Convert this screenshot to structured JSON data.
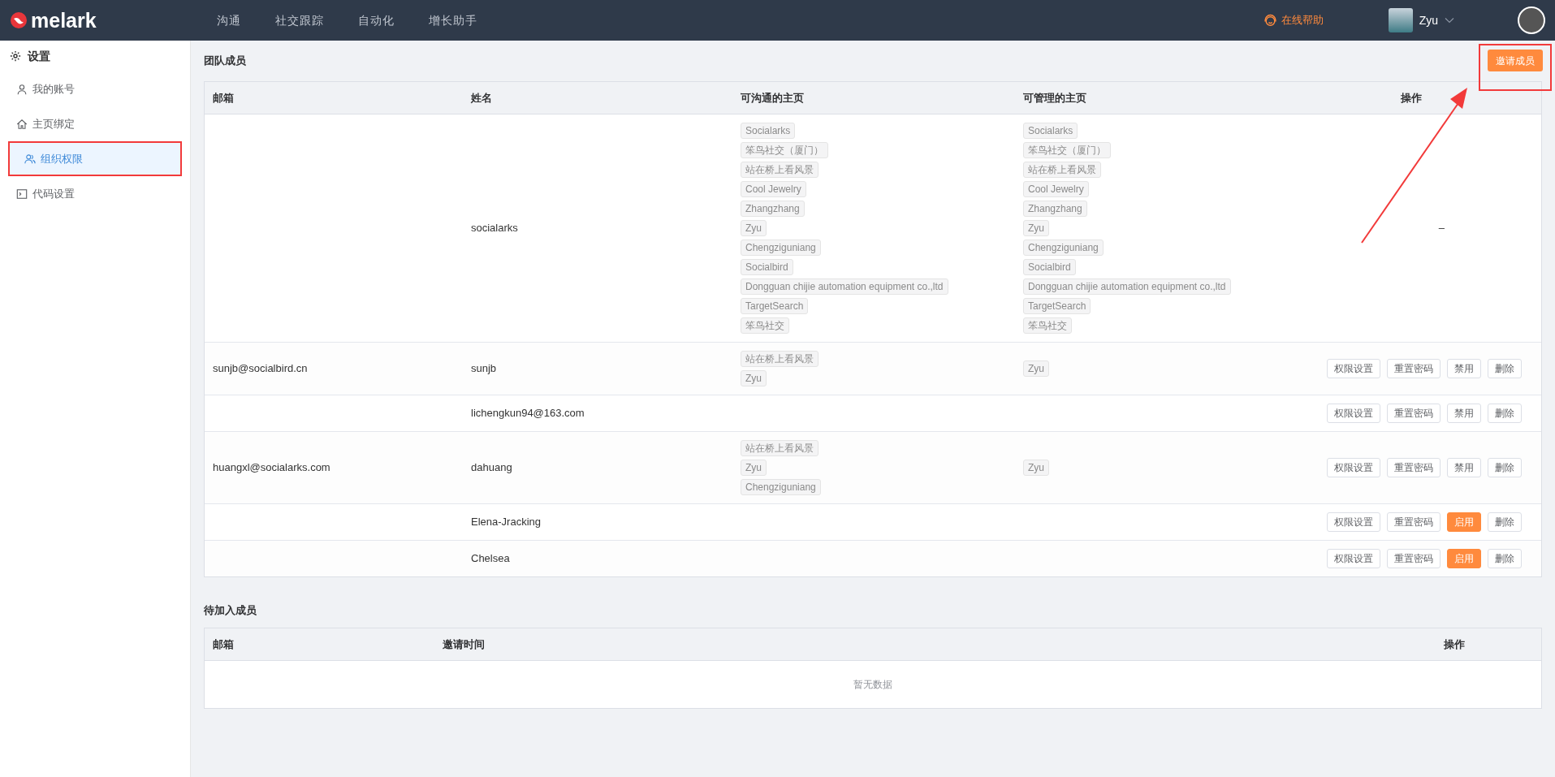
{
  "header": {
    "logo": "melark",
    "nav": [
      "沟通",
      "社交跟踪",
      "自动化",
      "增长助手"
    ],
    "help": "在线帮助",
    "account": "Zyu"
  },
  "sidebar": {
    "title": "设置",
    "items": [
      {
        "label": "我的账号",
        "kind": "user",
        "selected": false,
        "annotated": false
      },
      {
        "label": "主页绑定",
        "kind": "home",
        "selected": false,
        "annotated": false
      },
      {
        "label": "组织权限",
        "kind": "users",
        "selected": true,
        "annotated": true
      },
      {
        "label": "代码设置",
        "kind": "code",
        "selected": false,
        "annotated": false
      }
    ]
  },
  "team": {
    "title": "团队成员",
    "invite_button": {
      "label": "邀请成员",
      "annotated": true
    },
    "columns": [
      "邮箱",
      "姓名",
      "可沟通的主页",
      "可管理的主页",
      "操作"
    ],
    "rows": [
      {
        "email": "",
        "name": "socialarks",
        "chat_pages": [
          "Socialarks",
          "笨鸟社交（厦门）",
          "站在桥上看风景",
          "Cool Jewelry",
          "Zhangzhang",
          "Zyu",
          "Chengziguniang",
          "Socialbird",
          "Dongguan chijie automation equipment co.,ltd",
          "TargetSearch",
          "笨鸟社交"
        ],
        "manage_pages": [
          "Socialarks",
          "笨鸟社交（厦门）",
          "站在桥上看风景",
          "Cool Jewelry",
          "Zhangzhang",
          "Zyu",
          "Chengziguniang",
          "Socialbird",
          "Dongguan chijie automation equipment co.,ltd",
          "TargetSearch",
          "笨鸟社交"
        ],
        "no_actions": "–",
        "actions": []
      },
      {
        "email": "sunjb@socialbird.cn",
        "name": "sunjb",
        "chat_pages": [
          "站在桥上看风景",
          "Zyu"
        ],
        "manage_pages": [
          "Zyu"
        ],
        "actions": [
          {
            "label": "权限设置",
            "kind": "default"
          },
          {
            "label": "重置密码",
            "kind": "default"
          },
          {
            "label": "禁用",
            "kind": "default"
          },
          {
            "label": "删除",
            "kind": "default"
          }
        ]
      },
      {
        "email": "",
        "name": "lichengkun94@163.com",
        "chat_pages": [],
        "manage_pages": [],
        "actions": [
          {
            "label": "权限设置",
            "kind": "default"
          },
          {
            "label": "重置密码",
            "kind": "default"
          },
          {
            "label": "禁用",
            "kind": "default"
          },
          {
            "label": "删除",
            "kind": "default"
          }
        ]
      },
      {
        "email": "huangxl@socialarks.com",
        "name": "dahuang",
        "chat_pages": [
          "站在桥上看风景",
          "Zyu",
          "Chengziguniang"
        ],
        "manage_pages": [
          "Zyu"
        ],
        "actions": [
          {
            "label": "权限设置",
            "kind": "default"
          },
          {
            "label": "重置密码",
            "kind": "default"
          },
          {
            "label": "禁用",
            "kind": "default"
          },
          {
            "label": "删除",
            "kind": "default"
          }
        ]
      },
      {
        "email": "",
        "name": "Elena-Jracking",
        "chat_pages": [],
        "manage_pages": [],
        "actions": [
          {
            "label": "权限设置",
            "kind": "default"
          },
          {
            "label": "重置密码",
            "kind": "default"
          },
          {
            "label": "启用",
            "kind": "primary"
          },
          {
            "label": "删除",
            "kind": "default"
          }
        ]
      },
      {
        "email": "",
        "name": "Chelsea",
        "chat_pages": [],
        "manage_pages": [],
        "actions": [
          {
            "label": "权限设置",
            "kind": "default"
          },
          {
            "label": "重置密码",
            "kind": "default"
          },
          {
            "label": "启用",
            "kind": "primary"
          },
          {
            "label": "删除",
            "kind": "default"
          }
        ]
      }
    ]
  },
  "pending": {
    "title": "待加入成员",
    "columns": [
      "邮箱",
      "邀请时间",
      "操作"
    ],
    "empty": "暂无数据"
  }
}
